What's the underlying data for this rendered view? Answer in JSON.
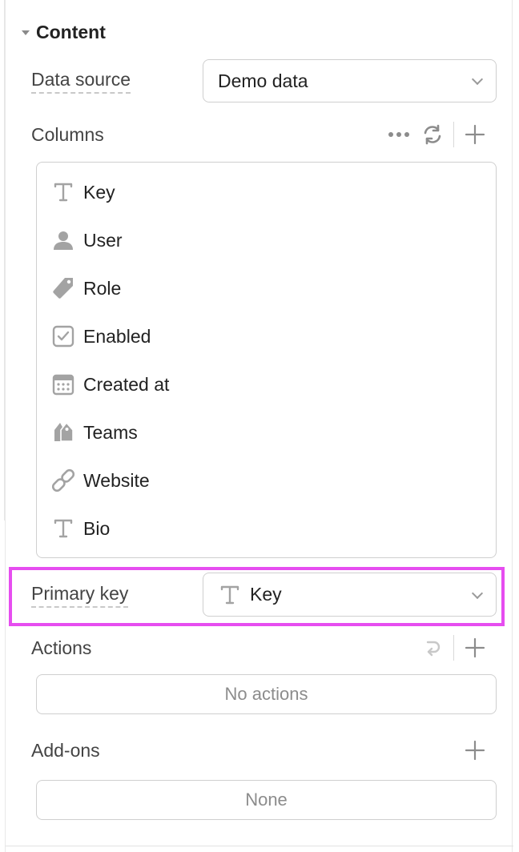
{
  "section": {
    "title": "Content"
  },
  "data_source": {
    "label": "Data source",
    "value": "Demo data"
  },
  "columns": {
    "label": "Columns",
    "items": [
      {
        "label": "Key",
        "icon": "text-type-icon"
      },
      {
        "label": "User",
        "icon": "user-icon"
      },
      {
        "label": "Role",
        "icon": "tag-icon"
      },
      {
        "label": "Enabled",
        "icon": "checkbox-icon"
      },
      {
        "label": "Created at",
        "icon": "calendar-icon"
      },
      {
        "label": "Teams",
        "icon": "tags-icon"
      },
      {
        "label": "Website",
        "icon": "link-icon"
      },
      {
        "label": "Bio",
        "icon": "text-type-icon"
      }
    ]
  },
  "primary_key": {
    "label": "Primary key",
    "value": "Key"
  },
  "actions": {
    "label": "Actions",
    "empty": "No actions"
  },
  "addons": {
    "label": "Add-ons",
    "empty": "None"
  },
  "colors": {
    "highlight": "#e64df0",
    "icon": "#a3a3a3",
    "border": "#cfcfcf"
  }
}
